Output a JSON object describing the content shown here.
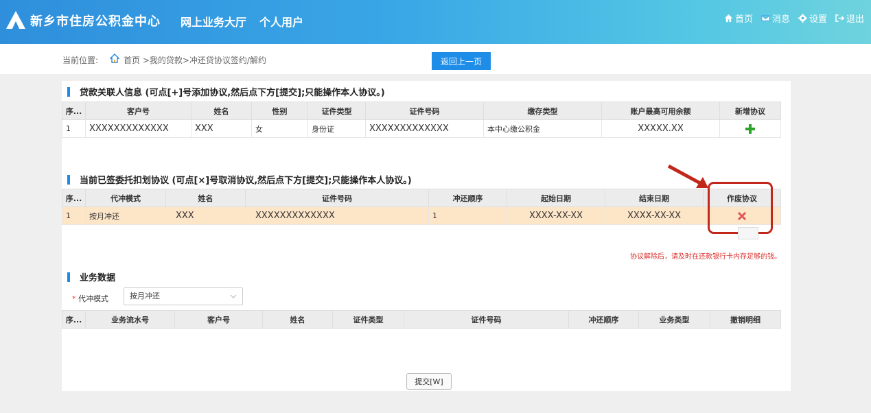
{
  "header": {
    "site_title": "新乡市住房公积金中心",
    "portal_title": "网上业务大厅",
    "user_type": "个人用户",
    "nav": [
      {
        "label": "首页",
        "icon": "home-icon"
      },
      {
        "label": "消息",
        "icon": "message-icon"
      },
      {
        "label": "设置",
        "icon": "gear-icon"
      },
      {
        "label": "退出",
        "icon": "logout-icon"
      }
    ]
  },
  "breadcrumb": {
    "label": "当前位置:",
    "path": "首页 >我的贷款>冲还贷协议签约/解约",
    "back_button": "返回上一页"
  },
  "section1": {
    "title": "贷款关联人信息 (可点[+]号添加协议,然后点下方[提交];只能操作本人协议。)",
    "columns": [
      "序...",
      "客户号",
      "姓名",
      "性别",
      "证件类型",
      "证件号码",
      "缴存类型",
      "账户最高可用余额",
      "新增协议"
    ],
    "rows": [
      {
        "seq": "1",
        "customer_no": "XXXXXXXXXXXXX",
        "name": "XXX",
        "gender": "女",
        "id_type": "身份证",
        "id_no": "XXXXXXXXXXXXX",
        "deposit_type": "本中心缴公积金",
        "max_balance": "XXXXX.XX",
        "action_icon": "plus-icon"
      }
    ]
  },
  "section2": {
    "title": "当前已签委托扣划协议 (可点[×]号取消协议,然后点下方[提交];只能操作本人协议。)",
    "columns": [
      "序...",
      "代冲模式",
      "姓名",
      "证件号码",
      "冲还顺序",
      "起始日期",
      "结束日期",
      "作废协议"
    ],
    "rows": [
      {
        "seq": "1",
        "mode": "按月冲还",
        "name": "XXX",
        "id_no": "XXXXXXXXXXXXX",
        "order": "1",
        "start_date": "XXXX-XX-XX",
        "end_date": "XXXX-XX-XX",
        "action_icon": "close-icon"
      }
    ],
    "notice": "协议解除后，请及时在还款银行卡内存足够的钱。"
  },
  "section3": {
    "title": "业务数据",
    "mode_label": "代冲模式",
    "mode_value": "按月冲还",
    "columns": [
      "序...",
      "业务流水号",
      "客户号",
      "姓名",
      "证件类型",
      "证件号码",
      "冲还顺序",
      "业务类型",
      "撤销明细"
    ]
  },
  "submit_button": "提交[W]",
  "colors": {
    "accent": "#1e8de8",
    "highlight_row": "#fde5c8",
    "annotation_red": "#c1271b",
    "add_green": "#2aa52a",
    "delete_red": "#e05555"
  }
}
